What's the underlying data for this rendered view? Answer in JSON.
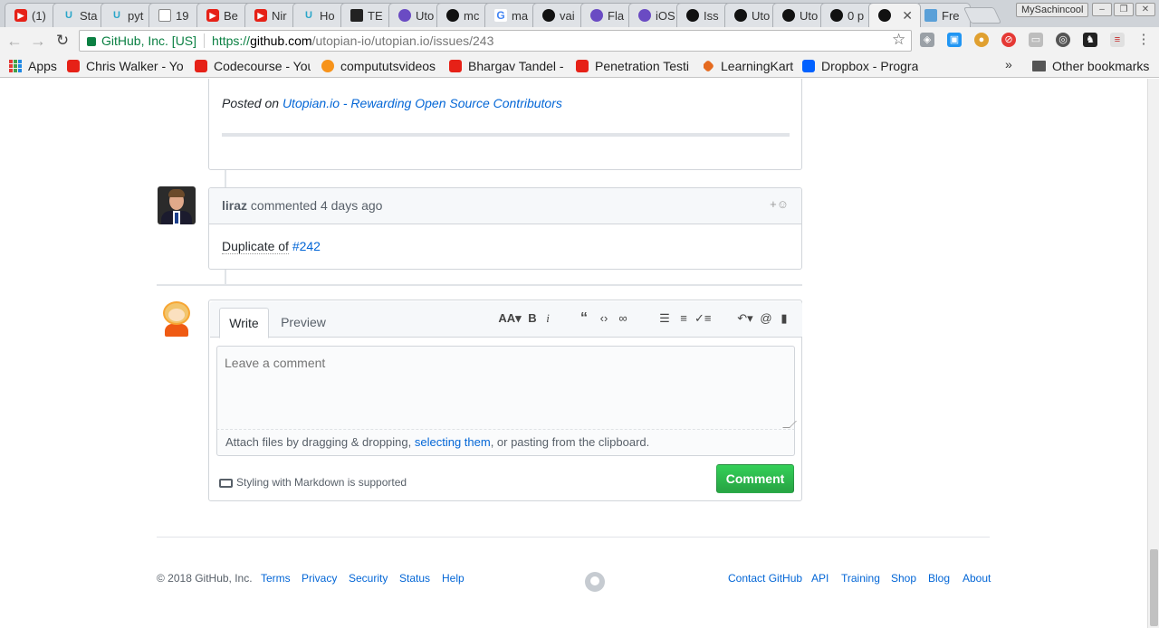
{
  "browser": {
    "tabs": [
      {
        "label": "(1)",
        "icon": "youtube-icon"
      },
      {
        "label": "Sta",
        "icon": "utopian-icon"
      },
      {
        "label": "pyt",
        "icon": "utopian-icon"
      },
      {
        "label": "19",
        "icon": "document-icon"
      },
      {
        "label": "Be",
        "icon": "youtube-icon"
      },
      {
        "label": "Nir",
        "icon": "youtube-icon"
      },
      {
        "label": "Ho",
        "icon": "utopian-icon"
      },
      {
        "label": "TE",
        "icon": "document-icon"
      },
      {
        "label": "Uto",
        "icon": "flat-icon"
      },
      {
        "label": "mc",
        "icon": "github-icon"
      },
      {
        "label": "ma",
        "icon": "google-icon"
      },
      {
        "label": "vai",
        "icon": "github-icon"
      },
      {
        "label": "Fla",
        "icon": "flat-icon"
      },
      {
        "label": "iOS",
        "icon": "flat-icon"
      },
      {
        "label": "Iss",
        "icon": "github-icon"
      },
      {
        "label": "Uto",
        "icon": "github-icon"
      },
      {
        "label": "Uto",
        "icon": "github-icon"
      },
      {
        "label": "0 p",
        "icon": "github-icon"
      },
      {
        "label": "",
        "icon": "github-icon",
        "active": true
      },
      {
        "label": "Fre",
        "icon": "freepik-icon"
      }
    ],
    "profile_name": "MySachincool",
    "security_label": "GitHub, Inc. [US]",
    "url": {
      "scheme": "https://",
      "host": "github.com",
      "path": "/utopian-io/utopian.io/issues/243"
    },
    "bookmarks": [
      {
        "label": "Apps",
        "icon": "apps-grid-icon"
      },
      {
        "label": "Chris Walker - Yo",
        "icon": "youtube-icon"
      },
      {
        "label": "Codecourse - You",
        "icon": "youtube-icon"
      },
      {
        "label": "compututsvideos",
        "icon": "bitcoin-icon"
      },
      {
        "label": "Bhargav Tandel -",
        "icon": "youtube-icon"
      },
      {
        "label": "Penetration Testi",
        "icon": "youtube-icon"
      },
      {
        "label": "LearningKart",
        "icon": "learningkart-icon"
      },
      {
        "label": "Dropbox - Progra",
        "icon": "dropbox-icon"
      }
    ],
    "other_bookmarks": "Other bookmarks"
  },
  "issue": {
    "posted": {
      "prefix": "Posted on ",
      "link": "Utopian.io -  Rewarding Open Source Contributors"
    },
    "comment": {
      "author": "liraz",
      "meta": " commented 4 days ago",
      "react": "+☺",
      "body_prefix": "Duplicate of",
      "body_link": "#242"
    },
    "editor": {
      "tab_write": "Write",
      "tab_preview": "Preview",
      "placeholder": "Leave a comment",
      "attach_prefix": "Attach files by dragging & dropping, ",
      "attach_link": "selecting them",
      "attach_suffix": ", or pasting from the clipboard.",
      "markdown_note": "Styling with Markdown is supported",
      "submit_label": "Comment"
    }
  },
  "footer": {
    "copyright": "© 2018 GitHub, Inc.",
    "left_links": [
      "Terms",
      "Privacy",
      "Security",
      "Status",
      "Help"
    ],
    "right_links": [
      "Contact GitHub",
      "API",
      "Training",
      "Shop",
      "Blog",
      "About"
    ]
  },
  "colors": {
    "accent": "#0366d6",
    "success": "#28a745",
    "border": "#d1d5da"
  }
}
